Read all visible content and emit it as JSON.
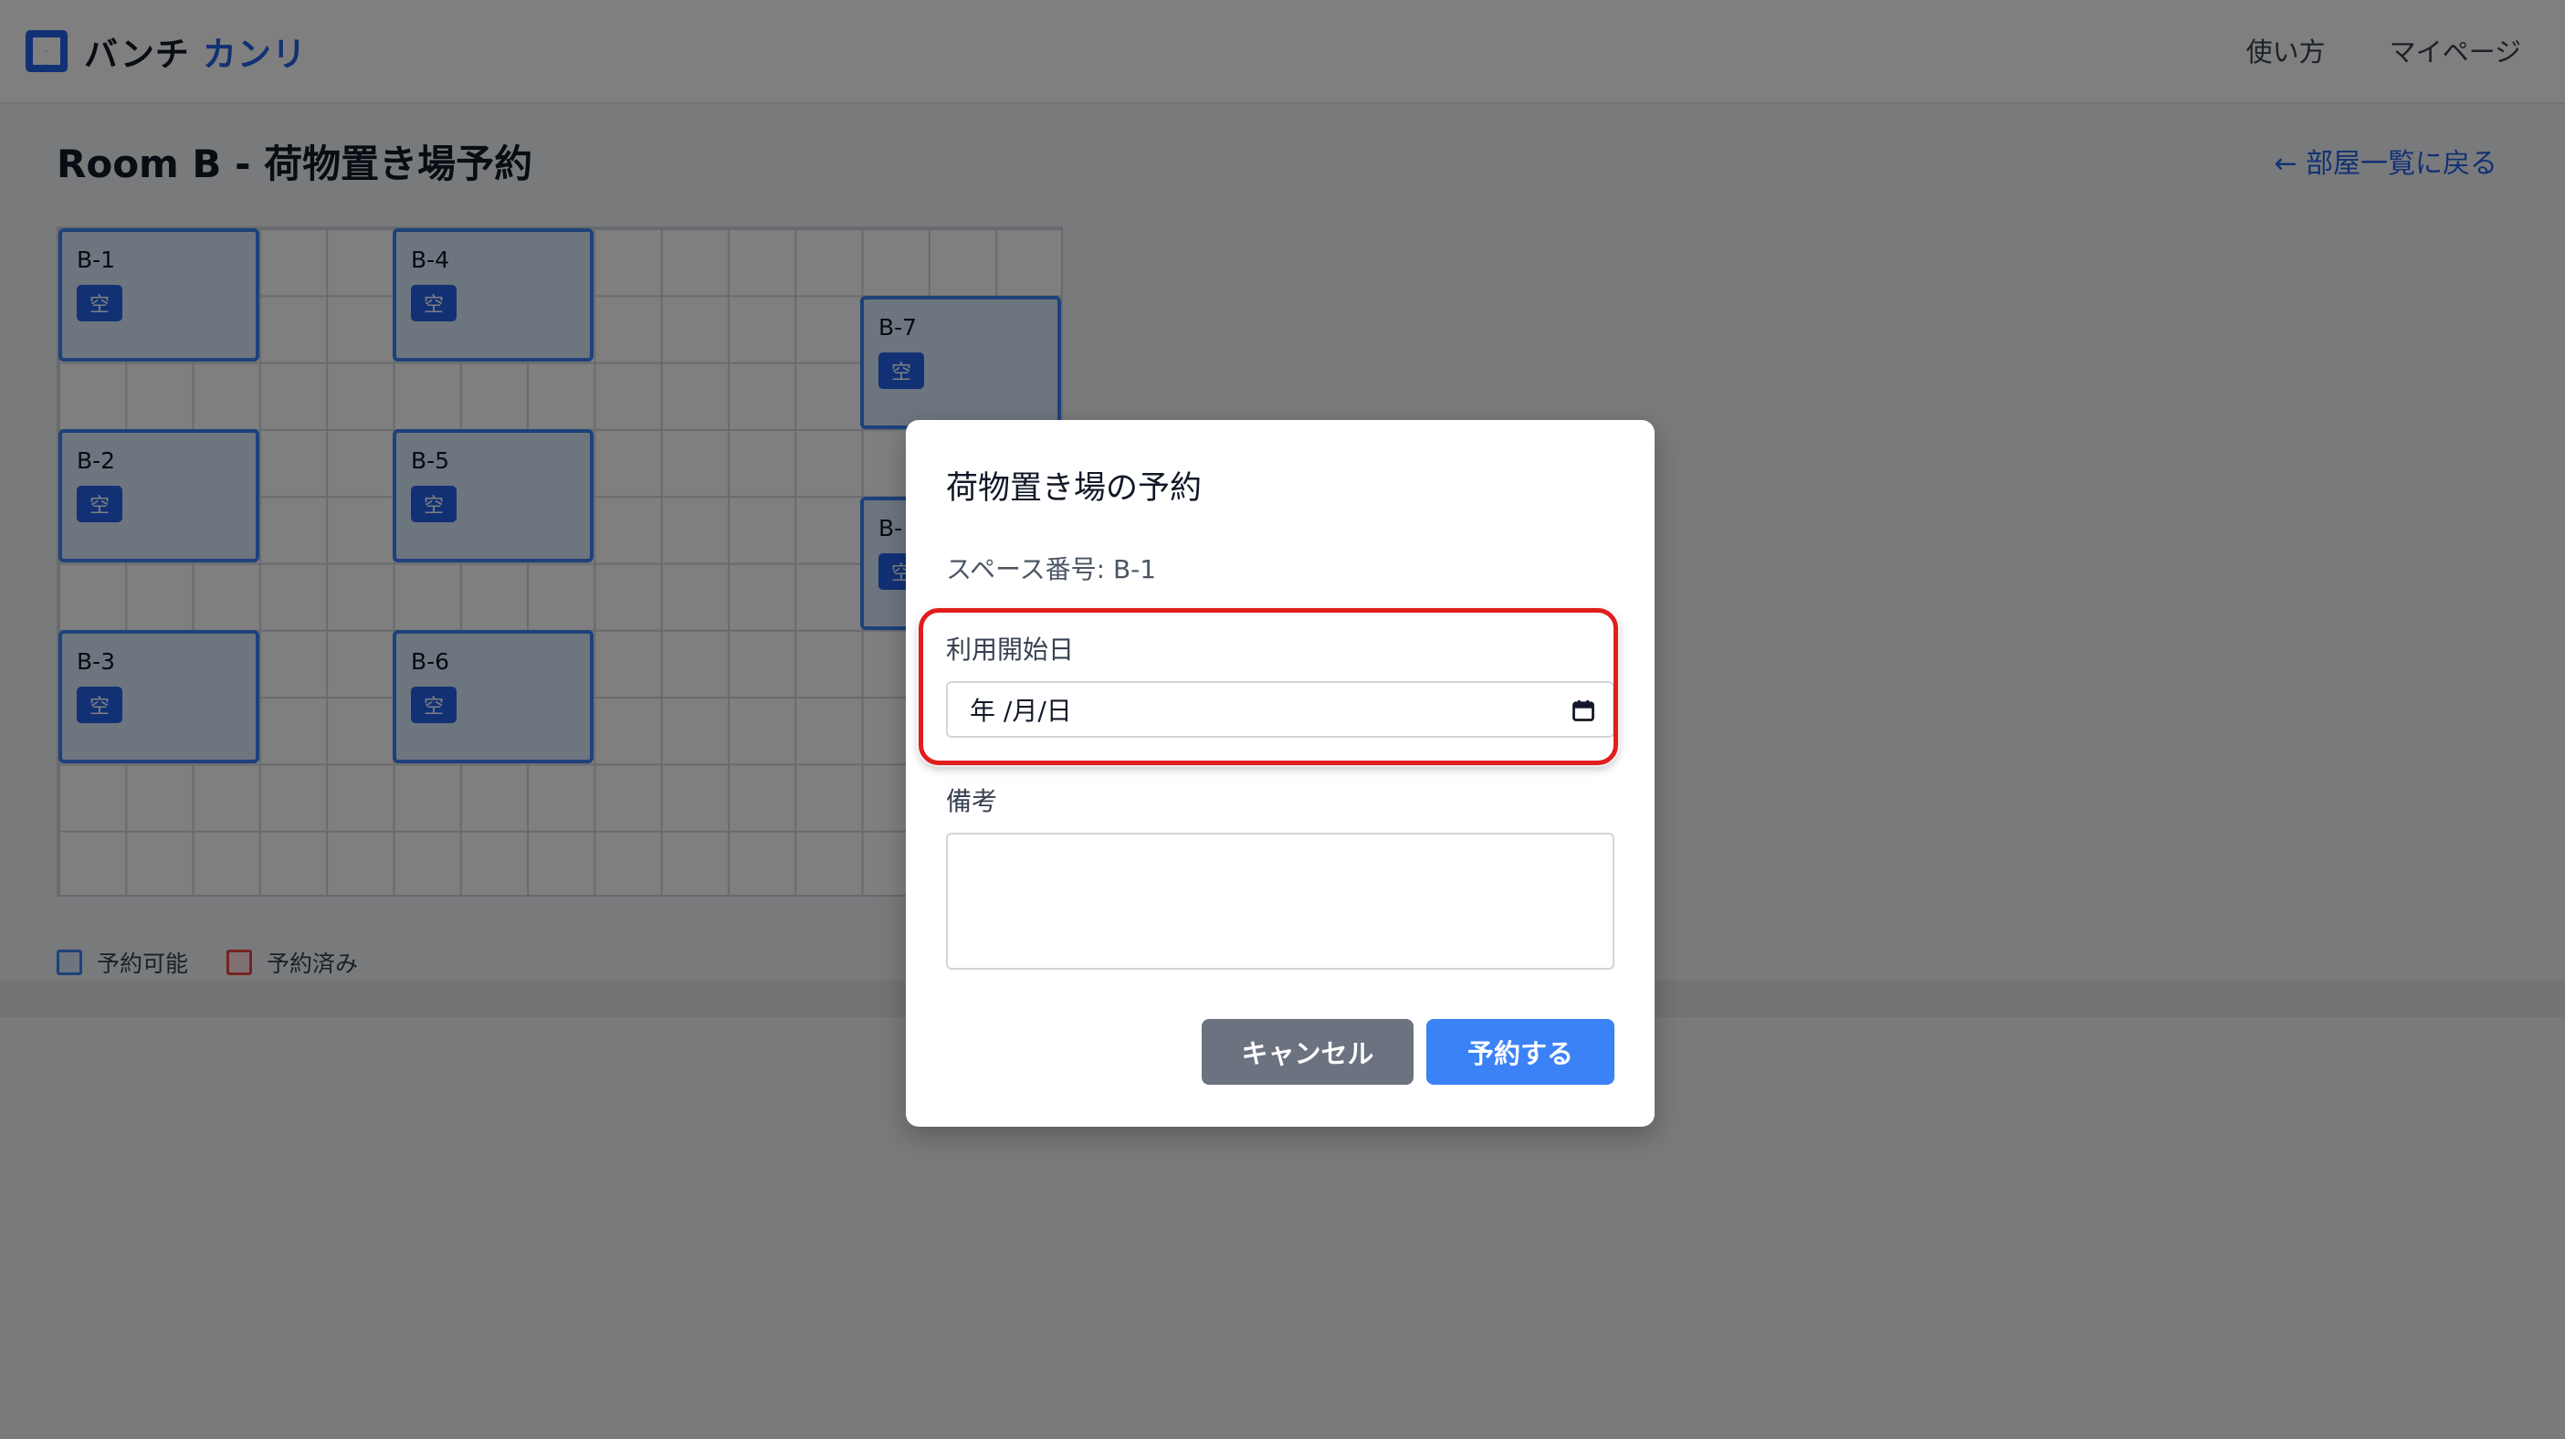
{
  "header": {
    "logo_main": "バンチ",
    "logo_accent": "カンリ",
    "nav": [
      "使い方",
      "マイページ"
    ]
  },
  "page": {
    "title": "Room B - 荷物置き場予約",
    "back_link": "← 部屋一覧に戻る"
  },
  "spaces": [
    {
      "label": "B-1",
      "status": "空"
    },
    {
      "label": "B-4",
      "status": "空"
    },
    {
      "label": "B-7",
      "status": "空"
    },
    {
      "label": "B-2",
      "status": "空"
    },
    {
      "label": "B-5",
      "status": "空"
    },
    {
      "label": "B-",
      "status": "空"
    },
    {
      "label": "B-3",
      "status": "空"
    },
    {
      "label": "B-6",
      "status": "空"
    }
  ],
  "legend": {
    "available": "予約可能",
    "booked": "予約済み"
  },
  "modal": {
    "title": "荷物置き場の予約",
    "space_number": "スペース番号: B-1",
    "start_date_label": "利用開始日",
    "start_date_placeholder": "年 /月/日",
    "notes_label": "備考",
    "notes_value": "",
    "cancel_label": "キャンセル",
    "submit_label": "予約する"
  },
  "colors": {
    "accent": "#2563eb",
    "available_border": "#3b82f6",
    "booked_border": "#ef4444",
    "highlight": "#e11d1d",
    "cancel_button": "#6b7280",
    "submit_button": "#3b82f6"
  }
}
